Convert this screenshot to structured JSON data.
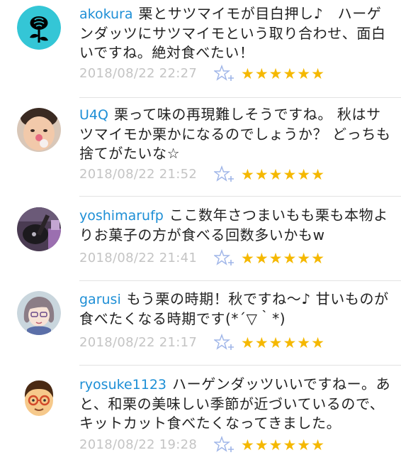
{
  "comments": [
    {
      "user": "akokura",
      "text": "栗とサツマイモが目白押し♪　ハーゲンダッツにサツマイモという取り合わせ、面白いですね。絶対食べたい！",
      "date": "2018/08/22 22:27",
      "stars": "★★★★★★",
      "avatar_icon": "rose-icon"
    },
    {
      "user": "U4Q",
      "text": "栗って味の再現難しそうですね。 秋はサツマイモか栗かになるのでしょうか？ どっちも捨てがたいな☆",
      "date": "2018/08/22 21:52",
      "stars": "★★★★★★",
      "avatar_icon": "baby-photo-icon"
    },
    {
      "user": "yoshimarufp",
      "text": "ここ数年さつまいもも栗も本物よりお菓子の方が食べる回数多いかもw",
      "date": "2018/08/22 21:41",
      "stars": "★★★★★★",
      "avatar_icon": "guitar-photo-icon"
    },
    {
      "user": "garusi",
      "text": "もう栗の時期！秋ですね～♪ 甘いものが食べたくなる時期です(*´▽｀*)",
      "date": "2018/08/22 21:17",
      "stars": "★★★★★★",
      "avatar_icon": "anime-girl-icon"
    },
    {
      "user": "ryosuke1123",
      "text": "ハーゲンダッツいいですねー。あと、和栗の美味しい季節が近づいているので、キットカット食べたくなってきました。",
      "date": "2018/08/22 19:28",
      "stars": "★★★★★★",
      "avatar_icon": "glasses-man-icon"
    }
  ],
  "colors": {
    "username": "#1e8fd6",
    "star": "#f5b800",
    "date": "#c4c4c4",
    "divider": "#e2e2e2",
    "avatar_rose_bg": "#34c6d6"
  }
}
